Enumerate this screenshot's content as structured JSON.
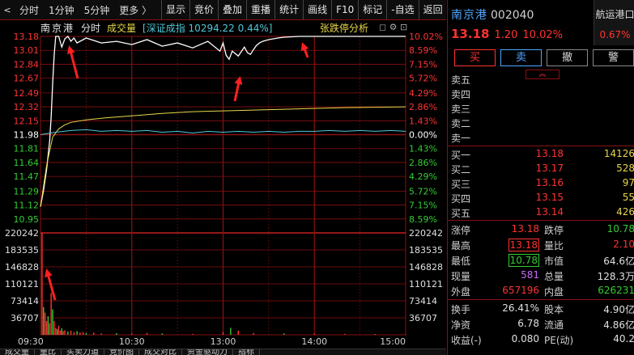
{
  "toolbar": {
    "items": [
      "分时",
      "1分钟",
      "5分钟",
      "更多 〉"
    ],
    "buttons": [
      "显示",
      "竞价",
      "叠加",
      "重播",
      "统计",
      "画线",
      "F10",
      "标记",
      "-自选",
      "返回"
    ]
  },
  "chart_header": {
    "stock_name": "南京港",
    "mode": "分时",
    "volume_label": "成交量",
    "index_label": "[深证成指 10294.22 0.44%]",
    "analysis": "张跌停分析",
    "icons": "◻ ⚙ ⊡"
  },
  "colors": {
    "up": "#ff3333",
    "down": "#33cc33",
    "price_line": "#ffffff",
    "avg_line": "#e8d84a",
    "index_line": "#4fc7d8",
    "grid": "#8a1010",
    "accent_blue": "#4fa6ff"
  },
  "chart_data": {
    "type": "line",
    "x_ticks": [
      "09:30",
      "10:30",
      "13:00",
      "14:00",
      "15:00"
    ],
    "price_ticks": [
      "13.18",
      "13.01",
      "12.84",
      "12.67",
      "12.49",
      "12.32",
      "12.15",
      "11.98",
      "11.81",
      "11.64",
      "11.47",
      "11.29",
      "11.12",
      "10.95"
    ],
    "pct_ticks": [
      "10.02%",
      "8.59%",
      "7.15%",
      "5.72%",
      "4.29%",
      "2.86%",
      "1.43%",
      "0.00%",
      "1.43%",
      "2.86%",
      "4.29%",
      "5.72%",
      "7.15%",
      "8.59%"
    ],
    "vol_ticks": [
      "220242",
      "183535",
      "146828",
      "110121",
      "73414",
      "36707"
    ],
    "ylim_price": [
      10.78,
      13.18
    ],
    "ylim_volume": [
      0,
      220242
    ],
    "prev_close": 11.98,
    "series": [
      {
        "key": "price",
        "x": [
          0,
          2,
          4,
          6,
          7,
          8,
          9,
          10,
          12,
          14,
          16,
          18,
          20,
          22,
          24,
          30,
          40,
          50,
          60,
          70,
          80,
          90,
          100,
          110,
          118,
          120,
          122,
          124,
          126,
          130,
          134,
          136,
          138,
          140,
          142,
          144,
          146,
          150,
          156,
          160,
          170,
          180,
          190,
          200,
          210,
          220,
          230,
          240
        ],
        "y": [
          11.1,
          11.3,
          11.55,
          11.9,
          12.2,
          12.6,
          12.95,
          13.18,
          13.18,
          13.05,
          13.15,
          13.18,
          13.12,
          13.16,
          13.1,
          13.16,
          13.1,
          13.12,
          13.08,
          13.14,
          13.06,
          13.1,
          13.04,
          13.12,
          13.0,
          13.1,
          12.95,
          12.9,
          13.0,
          12.94,
          13.05,
          12.98,
          12.96,
          13.02,
          13.07,
          13.1,
          13.12,
          13.14,
          13.16,
          13.17,
          13.18,
          13.18,
          13.18,
          13.18,
          13.18,
          13.18,
          13.18,
          13.18
        ]
      },
      {
        "key": "average",
        "x": [
          0,
          4,
          8,
          12,
          16,
          20,
          30,
          40,
          60,
          80,
          100,
          120,
          140,
          160,
          180,
          200,
          220,
          240
        ],
        "y": [
          11.1,
          11.6,
          11.95,
          12.05,
          12.1,
          12.13,
          12.16,
          12.18,
          12.21,
          12.24,
          12.26,
          12.27,
          12.28,
          12.29,
          12.3,
          12.31,
          12.315,
          12.32
        ]
      },
      {
        "key": "index",
        "x": [
          0,
          10,
          20,
          30,
          40,
          50,
          60,
          70,
          80,
          90,
          100,
          110,
          120,
          130,
          140,
          150,
          160,
          170,
          180,
          190,
          200,
          210,
          220,
          230,
          240
        ],
        "y": [
          11.98,
          12.01,
          12.03,
          12.04,
          12.02,
          12.03,
          12.02,
          12.03,
          12.01,
          12.02,
          12.0,
          12.02,
          12.01,
          12.02,
          12.01,
          12.02,
          12.01,
          12.02,
          12.02,
          12.03,
          12.02,
          12.03,
          12.02,
          12.03,
          12.02
        ]
      },
      {
        "key": "volume",
        "x": [
          1,
          2,
          3,
          4,
          5,
          6,
          7,
          8,
          9,
          10,
          11,
          12,
          13,
          14,
          15,
          16,
          18,
          20,
          22,
          24,
          26,
          28,
          30,
          35,
          40,
          50,
          60,
          70,
          80,
          100,
          120,
          125,
          130,
          140,
          160,
          180,
          200,
          220,
          240
        ],
        "y": [
          220242,
          60000,
          48000,
          30000,
          40000,
          25000,
          90000,
          55000,
          30000,
          15000,
          12000,
          20000,
          9000,
          14000,
          8000,
          10000,
          7000,
          9000,
          6000,
          8000,
          5000,
          6000,
          4000,
          5000,
          3000,
          3500,
          2500,
          4000,
          3000,
          2000,
          6000,
          15000,
          9000,
          4000,
          3000,
          2500,
          2000,
          1500,
          1000
        ]
      }
    ]
  },
  "panel": {
    "stock_name": "南京港",
    "stock_code": "002040",
    "side_name": "航运港口",
    "side_pct": "0.67%",
    "price": "13.18",
    "change": "1.20",
    "change_pct": "10.02%",
    "buttons": [
      "买",
      "卖",
      "撤",
      "警"
    ],
    "chevron": "︽",
    "asks": [
      {
        "label": "卖五",
        "price": "",
        "vol": ""
      },
      {
        "label": "卖四",
        "price": "",
        "vol": ""
      },
      {
        "label": "卖三",
        "price": "",
        "vol": ""
      },
      {
        "label": "卖二",
        "price": "",
        "vol": ""
      },
      {
        "label": "卖一",
        "price": "",
        "vol": ""
      }
    ],
    "bids": [
      {
        "label": "买一",
        "price": "13.18",
        "vol": "14126"
      },
      {
        "label": "买二",
        "price": "13.17",
        "vol": "528"
      },
      {
        "label": "买三",
        "price": "13.16",
        "vol": "97"
      },
      {
        "label": "买四",
        "price": "13.15",
        "vol": "55"
      },
      {
        "label": "买五",
        "price": "13.14",
        "vol": "426"
      }
    ],
    "stats1": [
      {
        "l1": "涨停",
        "v1": "13.18",
        "c1": "up",
        "l2": "跌停",
        "v2": "10.78",
        "c2": "down"
      },
      {
        "l1": "最高",
        "v1": "13.18",
        "c1": "up-box",
        "l2": "量比",
        "v2": "2.10",
        "c2": "up"
      },
      {
        "l1": "最低",
        "v1": "10.78",
        "c1": "down-box",
        "l2": "市值",
        "v2": "64.6亿",
        "c2": "white"
      },
      {
        "l1": "现量",
        "v1": "581",
        "c1": "purple",
        "l2": "总量",
        "v2": "128.3万",
        "c2": "white"
      },
      {
        "l1": "外盘",
        "v1": "657196",
        "c1": "up",
        "l2": "内盘",
        "v2": "626231",
        "c2": "down"
      }
    ],
    "stats2": [
      {
        "l1": "换手",
        "v1": "26.41%",
        "c1": "white",
        "l2": "股本",
        "v2": "4.90亿",
        "c2": "white"
      },
      {
        "l1": "净资",
        "v1": "6.78",
        "c1": "white",
        "l2": "流通",
        "v2": "4.86亿",
        "c2": "white"
      },
      {
        "l1": "收益(-)",
        "v1": "0.080",
        "c1": "white",
        "l2": "PE(动)",
        "v2": "40.2",
        "c2": "white"
      }
    ]
  },
  "bottom_tabs": [
    "成交量",
    "量比",
    "买卖力道",
    "竞价图",
    "成交对比",
    "资金驱动力",
    "指标"
  ]
}
